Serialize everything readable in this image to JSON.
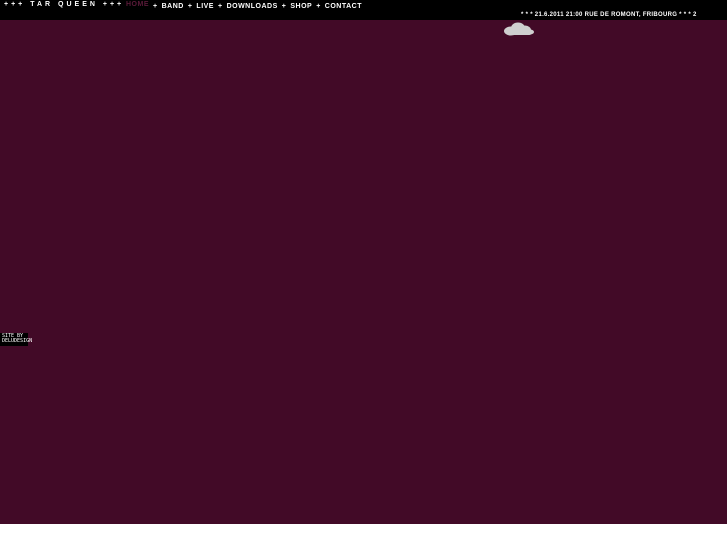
{
  "header": {
    "brand": "+++ TAR QUEEN +++",
    "nav": [
      {
        "label": "HOME",
        "active": true
      },
      {
        "label": "BAND",
        "active": false
      },
      {
        "label": "LIVE",
        "active": false
      },
      {
        "label": "DOWNLOADS",
        "active": false
      },
      {
        "label": "SHOP",
        "active": false
      },
      {
        "label": "CONTACT",
        "active": false
      }
    ],
    "separator": "+"
  },
  "ticker": {
    "text": "* * * 21.6.2011 21:00 RUE DE ROMONT, FRIBOURG * * * 2"
  },
  "decor": {
    "cloud_icon": "cloud-icon"
  },
  "credit": {
    "line1": "SITE BY",
    "line2": "DELUDESIGN"
  },
  "colors": {
    "background": "#420a27",
    "bar": "#000000",
    "text": "#ffffff",
    "active_nav": "#5a1a39",
    "cloud": "#cfcfcf"
  }
}
